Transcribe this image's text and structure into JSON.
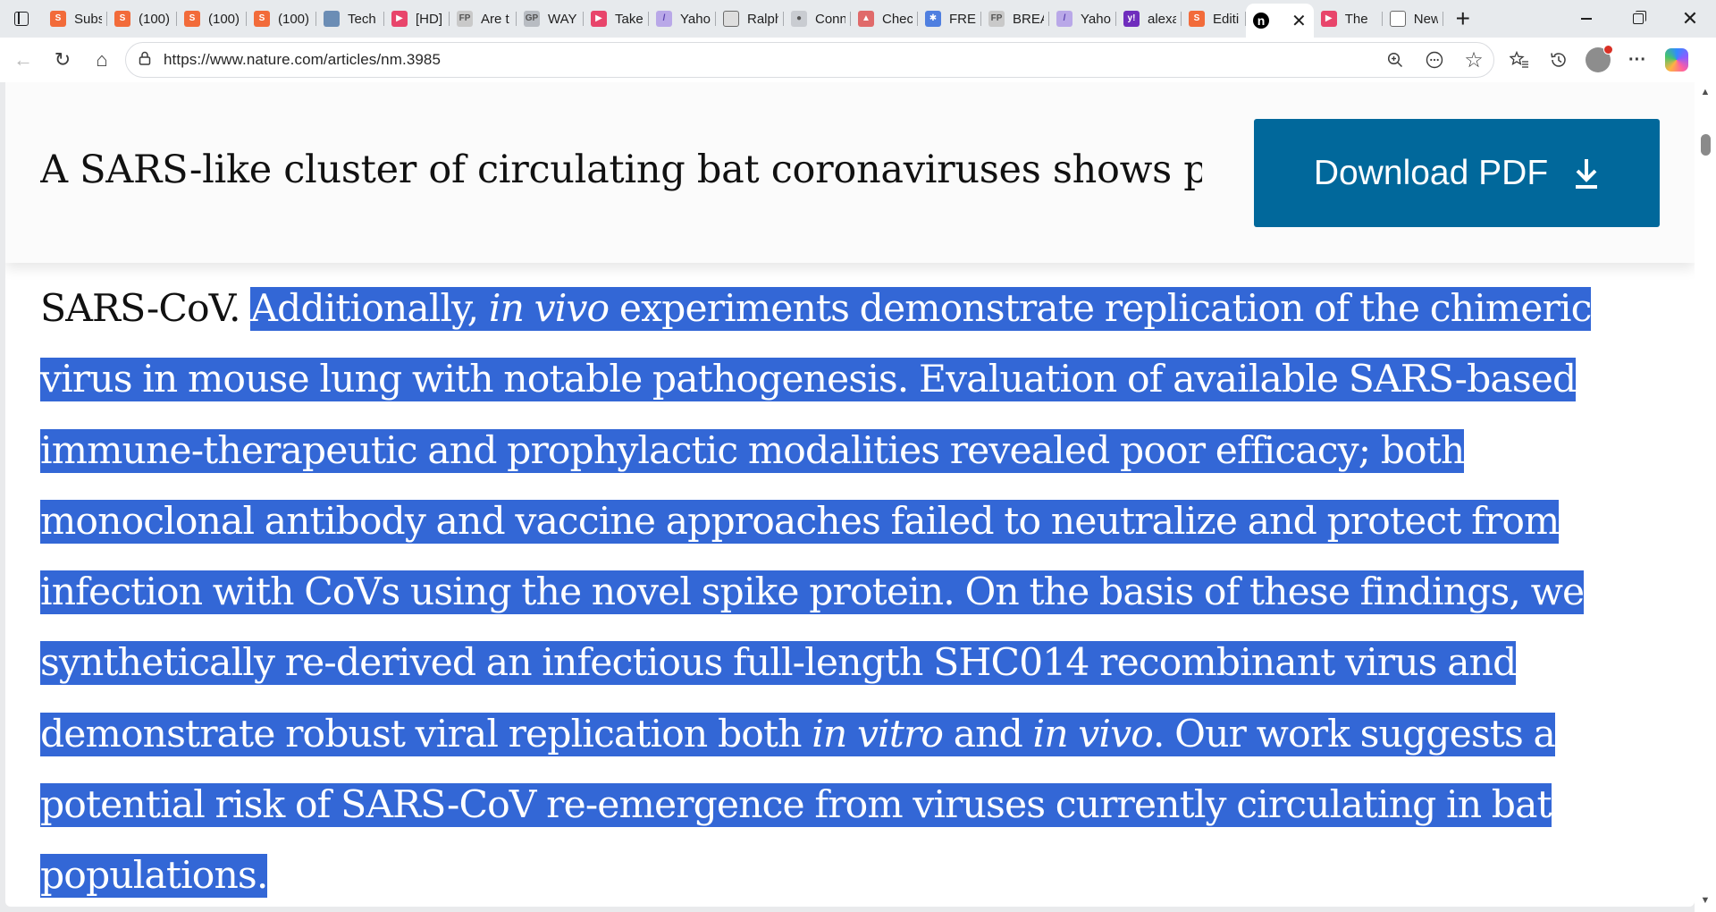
{
  "browser": {
    "tabs": [
      {
        "label": "Subs",
        "icon": "substack-icon",
        "color": "#f26b3a",
        "glyph": "S",
        "width": 72
      },
      {
        "label": "(100)",
        "icon": "substack-icon",
        "color": "#f26b3a",
        "glyph": "S",
        "width": 78
      },
      {
        "label": "(100)",
        "icon": "substack-icon",
        "color": "#f26b3a",
        "glyph": "S",
        "width": 78
      },
      {
        "label": "(100)",
        "icon": "substack-icon",
        "color": "#f26b3a",
        "glyph": "S",
        "width": 78
      },
      {
        "label": "Tech",
        "icon": "thumbnail-icon",
        "color": "#6b8db5",
        "glyph": "",
        "width": 76
      },
      {
        "label": "[HD]",
        "icon": "youtube-icon",
        "color": "#e8456b",
        "glyph": "▶",
        "width": 73
      },
      {
        "label": "Are t",
        "icon": "fp-icon",
        "color": "#c9c9c9",
        "glyph": "FP",
        "width": 75
      },
      {
        "label": "WAY",
        "icon": "gp-icon",
        "color": "#b8bcc2",
        "glyph": "GP",
        "width": 75
      },
      {
        "label": "Take",
        "icon": "youtube-icon",
        "color": "#e8456b",
        "glyph": "▶",
        "width": 73
      },
      {
        "label": "Yaho",
        "icon": "yahoo-icon",
        "color": "#b9a8e8",
        "glyph": "/",
        "width": 75
      },
      {
        "label": "Ralph",
        "icon": "blank-page-icon",
        "color": "#dedede",
        "glyph": "",
        "width": 76
      },
      {
        "label": "Conn",
        "icon": "seal-icon",
        "color": "#c9ccd1",
        "glyph": "●",
        "width": 75
      },
      {
        "label": "Chec",
        "icon": "shield-icon",
        "color": "#e06a6a",
        "glyph": "▲",
        "width": 75
      },
      {
        "label": "FREE",
        "icon": "star-badge-icon",
        "color": "#4f7fe0",
        "glyph": "✱",
        "width": 71
      },
      {
        "label": "BREA",
        "icon": "fp-icon",
        "color": "#c9c9c9",
        "glyph": "FP",
        "width": 76
      },
      {
        "label": "Yaho",
        "icon": "yahoo-icon",
        "color": "#b9a8e8",
        "glyph": "/",
        "width": 75
      },
      {
        "label": "alexa",
        "icon": "yahoo-purple-icon",
        "color": "#6f2dbd",
        "glyph": "y!",
        "width": 73
      },
      {
        "label": "Editi",
        "icon": "substack-icon",
        "color": "#f26b3a",
        "glyph": "S",
        "width": 72
      }
    ],
    "active_tab": {
      "icon": "nature-icon",
      "color": "#000000",
      "glyph": "n",
      "close_glyph": "✕"
    },
    "tabs_after": [
      {
        "label": "The",
        "icon": "youtube-icon",
        "color": "#e8456b",
        "glyph": "▶",
        "width": 77
      },
      {
        "label": "New",
        "icon": "new-tab-page-icon",
        "color": "#ffffff",
        "glyph": "",
        "width": 68
      }
    ],
    "new_tab_glyph": "+",
    "window_controls": {
      "close_glyph": "✕"
    },
    "toolbar": {
      "back_glyph": "←",
      "refresh_glyph": "↻",
      "home_glyph": "⌂",
      "lock_glyph": "🔒",
      "url": "https://www.nature.com/articles/nm.3985",
      "zoom_glyph": "⊕",
      "more_addr_glyph": "⊙",
      "favorite_glyph": "☆",
      "favorites_glyph": "☆≡",
      "history_glyph": "⟲",
      "menu_glyph": "···"
    }
  },
  "page": {
    "article_title": "A SARS-like cluster of circulating bat coronaviruses shows pot…",
    "download_button_label": "Download PDF",
    "abstract": {
      "lead": "SARS-CoV. ",
      "s1": "Additionally, ",
      "i1": "in vivo",
      "s2": " experiments demonstrate replication of the chimeric virus in mouse lung with notable pathogenesis. Evaluation of available SARS-based immune-therapeutic and prophylactic modalities revealed poor efficacy; both monoclonal antibody and vaccine approaches failed to neutralize and protect from infection with CoVs using the novel spike protein. On the basis of these findings, we synthetically re-derived an infectious full-length SHC014 recombinant virus and demonstrate robust viral replication both ",
      "i2": "in vitro",
      "s3": " and ",
      "i3": "in vivo",
      "s4": ". Our work suggests a potential risk of SARS-CoV re-emergence from viruses currently circulating in bat populations."
    },
    "colors": {
      "accent": "#01689b",
      "selection": "#3367d6"
    }
  }
}
